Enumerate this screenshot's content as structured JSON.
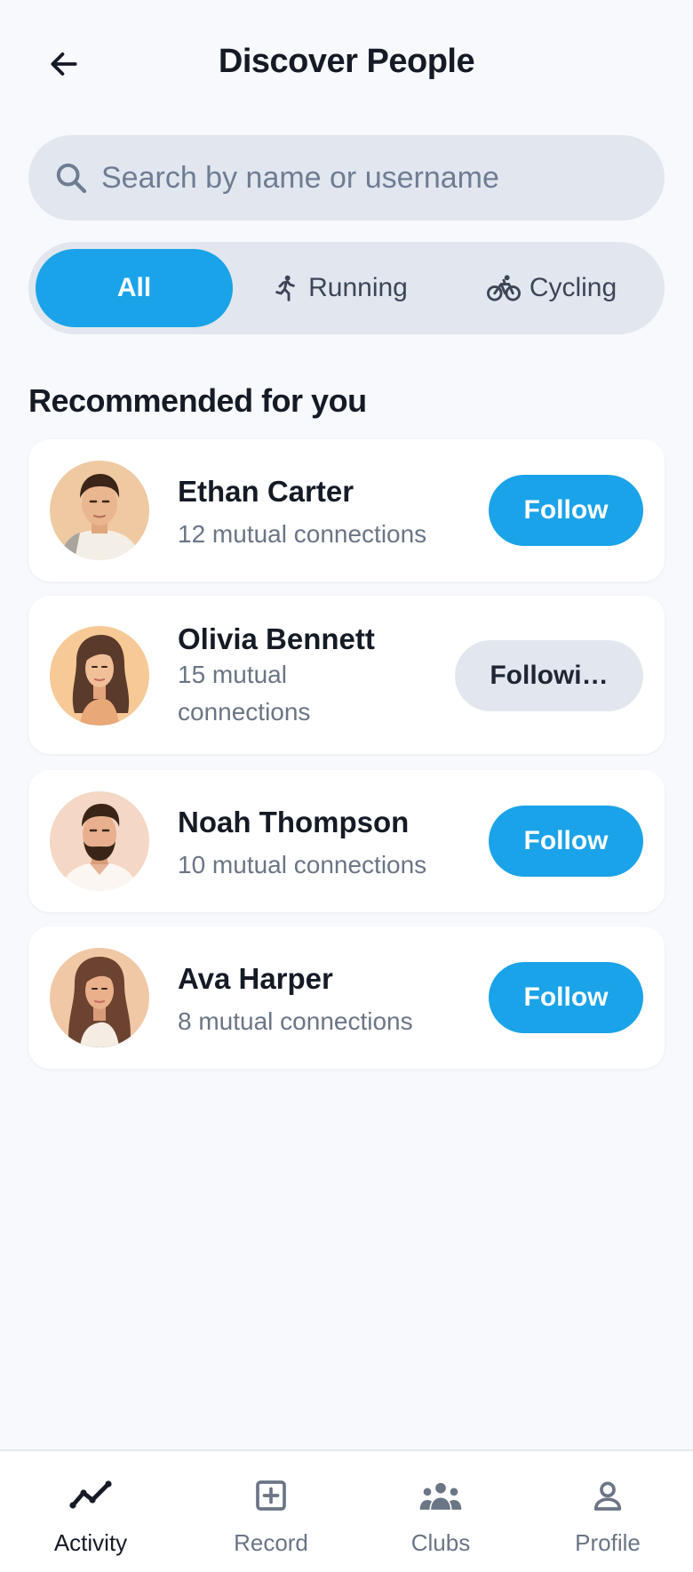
{
  "header": {
    "title": "Discover People"
  },
  "search": {
    "placeholder": "Search by name or username"
  },
  "filters": [
    {
      "label": "All",
      "icon": "none",
      "active": true
    },
    {
      "label": "Running",
      "icon": "running-icon",
      "active": false
    },
    {
      "label": "Cycling",
      "icon": "cycling-icon",
      "active": false
    }
  ],
  "section": {
    "title": "Recommended for you"
  },
  "people": [
    {
      "name": "Ethan Carter",
      "mutual": "12 mutual connections",
      "button": "Follow",
      "following": false
    },
    {
      "name": "Olivia Bennett",
      "mutual": "15 mutual connections",
      "mutual_line1": "15 mutual",
      "mutual_line2": "connections",
      "button": "Followi…",
      "following": true
    },
    {
      "name": "Noah Thompson",
      "mutual": "10 mutual connections",
      "button": "Follow",
      "following": false
    },
    {
      "name": "Ava Harper",
      "mutual": "8 mutual connections",
      "button": "Follow",
      "following": false
    }
  ],
  "tabbar": {
    "items": [
      {
        "label": "Activity",
        "icon": "activity-icon",
        "active": true
      },
      {
        "label": "Record",
        "icon": "record-icon",
        "active": false
      },
      {
        "label": "Clubs",
        "icon": "clubs-icon",
        "active": false
      },
      {
        "label": "Profile",
        "icon": "profile-icon",
        "active": false
      }
    ]
  },
  "colors": {
    "accent": "#1aa3e8",
    "background": "#f7f9fc",
    "surface": "#ffffff",
    "muted_fill": "#e2e7ef",
    "text_primary": "#151b26",
    "text_secondary": "#6a7586"
  }
}
